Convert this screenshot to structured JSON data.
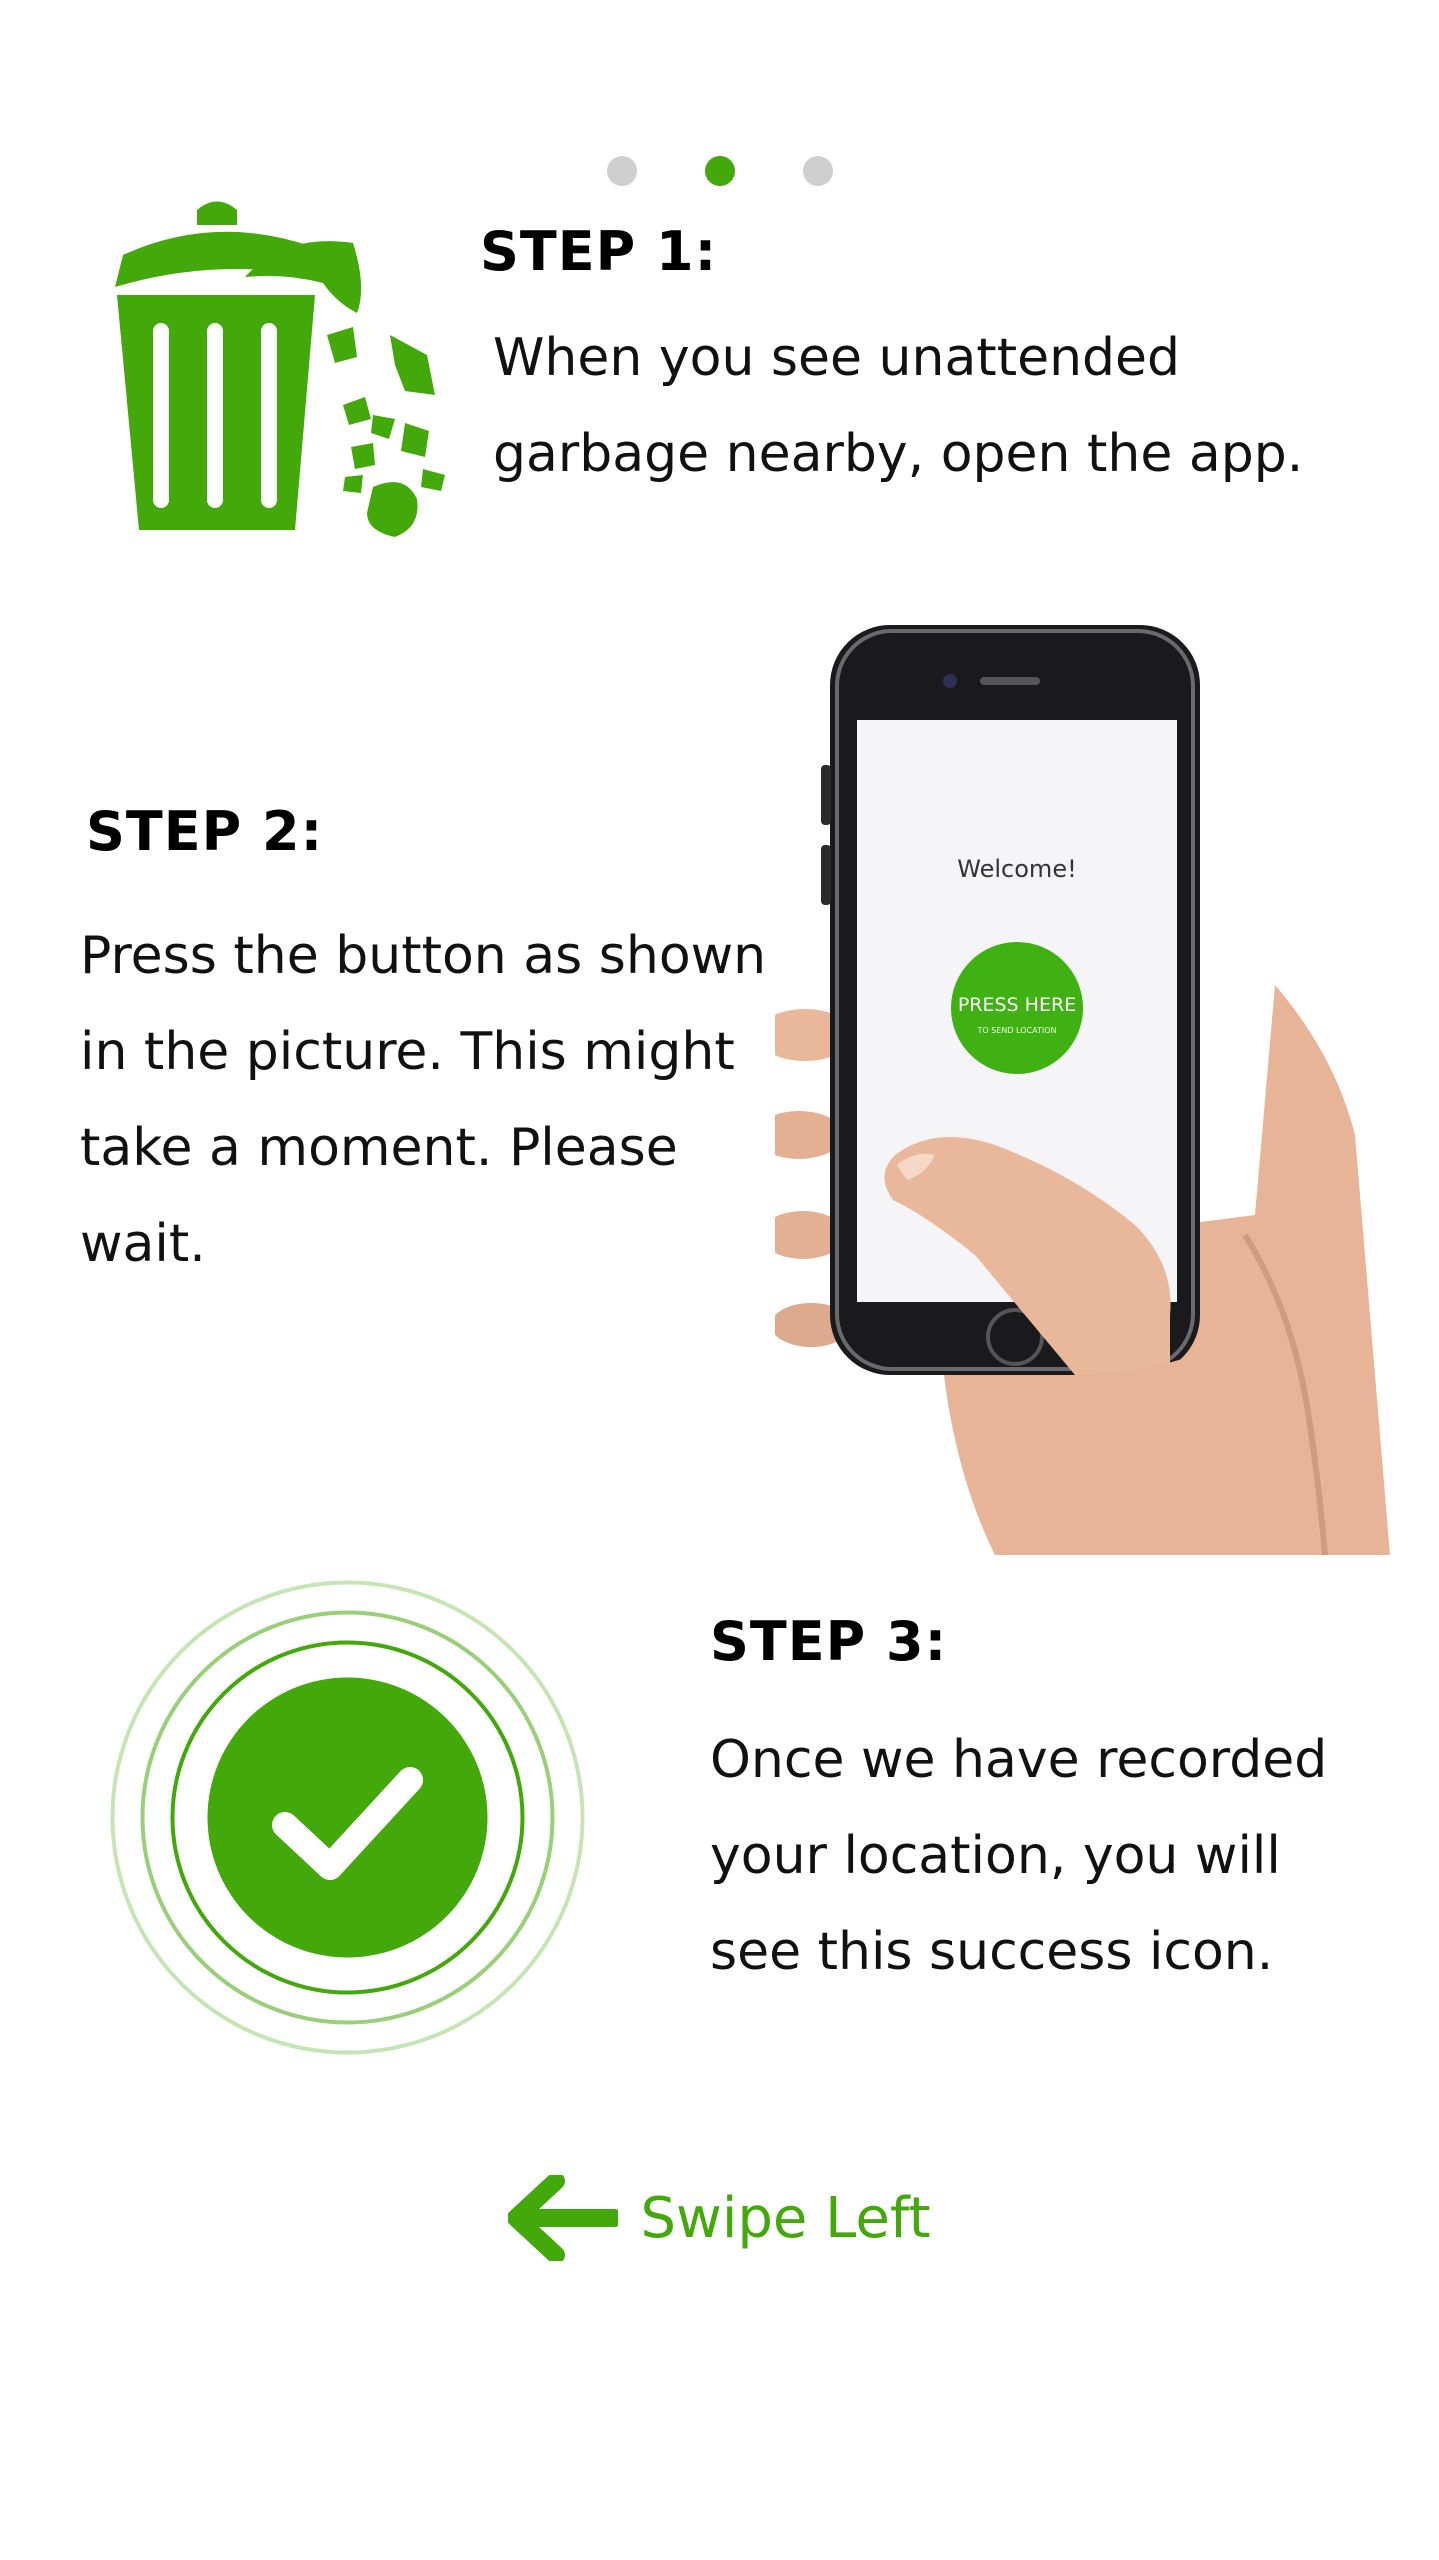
{
  "pager": {
    "count": 3,
    "active_index": 1
  },
  "step1": {
    "title": "STEP 1:",
    "lines": [
      "When you see unattended",
      "garbage nearby, open the app."
    ],
    "icon": "trash-can-icon"
  },
  "step2": {
    "title": "STEP 2:",
    "lines": [
      "Press the button as shown",
      "in the picture. This might",
      "take a moment. Please",
      "wait."
    ],
    "phone": {
      "welcome": "Welcome!",
      "button_label": "PRESS HERE",
      "button_sub": "TO SEND LOCATION"
    }
  },
  "step3": {
    "title": "STEP 3:",
    "lines": [
      "Once we have recorded",
      "your location, you will",
      "see this success icon."
    ],
    "icon": "checkmark-icon"
  },
  "swipe": {
    "label": "Swipe Left",
    "icon": "arrow-left-icon"
  },
  "colors": {
    "accent": "#43a80a",
    "dot_inactive": "#cfcfcf",
    "text": "#111111"
  }
}
